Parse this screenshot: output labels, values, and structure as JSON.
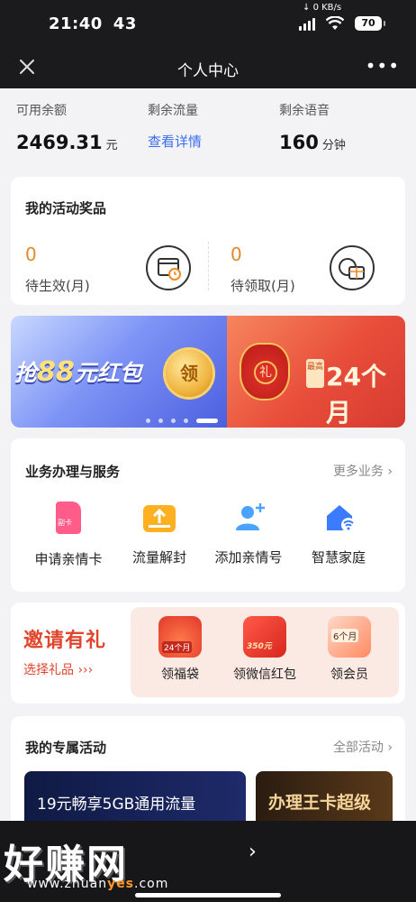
{
  "status_bar": {
    "time": "21:40",
    "extra": "43",
    "net_speed": "0 KB/s",
    "battery": "70"
  },
  "nav": {
    "title": "个人中心"
  },
  "summary": {
    "balance_label": "可用余额",
    "balance_value": "2469.31",
    "balance_unit": "元",
    "data_label": "剩余流量",
    "data_link": "查看详情",
    "voice_label": "剩余语音",
    "voice_value": "160",
    "voice_unit": "分钟"
  },
  "rewards": {
    "title": "我的活动奖品",
    "pending_count": "0",
    "pending_label": "待生效(月)",
    "unclaimed_count": "0",
    "unclaimed_label": "待领取(月)"
  },
  "banners": {
    "left_prefix": "抢",
    "left_amount": "88",
    "left_suffix": "元红包",
    "left_coin": "领",
    "right_bag_char": "礼",
    "right_tag": "最高",
    "right_text": "24个月"
  },
  "services": {
    "title": "业务办理与服务",
    "more": "更多业务",
    "items": [
      {
        "label": "申请亲情卡",
        "icon": "sim-card-icon",
        "badge": "副卡"
      },
      {
        "label": "流量解封",
        "icon": "data-unlock-icon"
      },
      {
        "label": "添加亲情号",
        "icon": "add-family-icon"
      },
      {
        "label": "智慧家庭",
        "icon": "smart-home-icon"
      }
    ]
  },
  "invite": {
    "title": "邀请有礼",
    "subtitle": "选择礼品",
    "gifts": [
      {
        "label": "领福袋",
        "badge": "24个月"
      },
      {
        "label": "领微信红包",
        "badge": "350元"
      },
      {
        "label": "领会员",
        "badge": "6个月"
      }
    ]
  },
  "activities": {
    "title": "我的专属活动",
    "more": "全部活动",
    "items": [
      {
        "text": "19元畅享5GB通用流量"
      },
      {
        "text": "办理王卡超级"
      }
    ]
  },
  "watermark": {
    "brand": "好赚网",
    "url_prefix": "www.zhuan",
    "url_highlight": "yes",
    "url_suffix": ".com"
  },
  "colors": {
    "accent_blue": "#3b6df0",
    "reward_orange": "#e08a28",
    "invite_red": "#e0452d"
  }
}
